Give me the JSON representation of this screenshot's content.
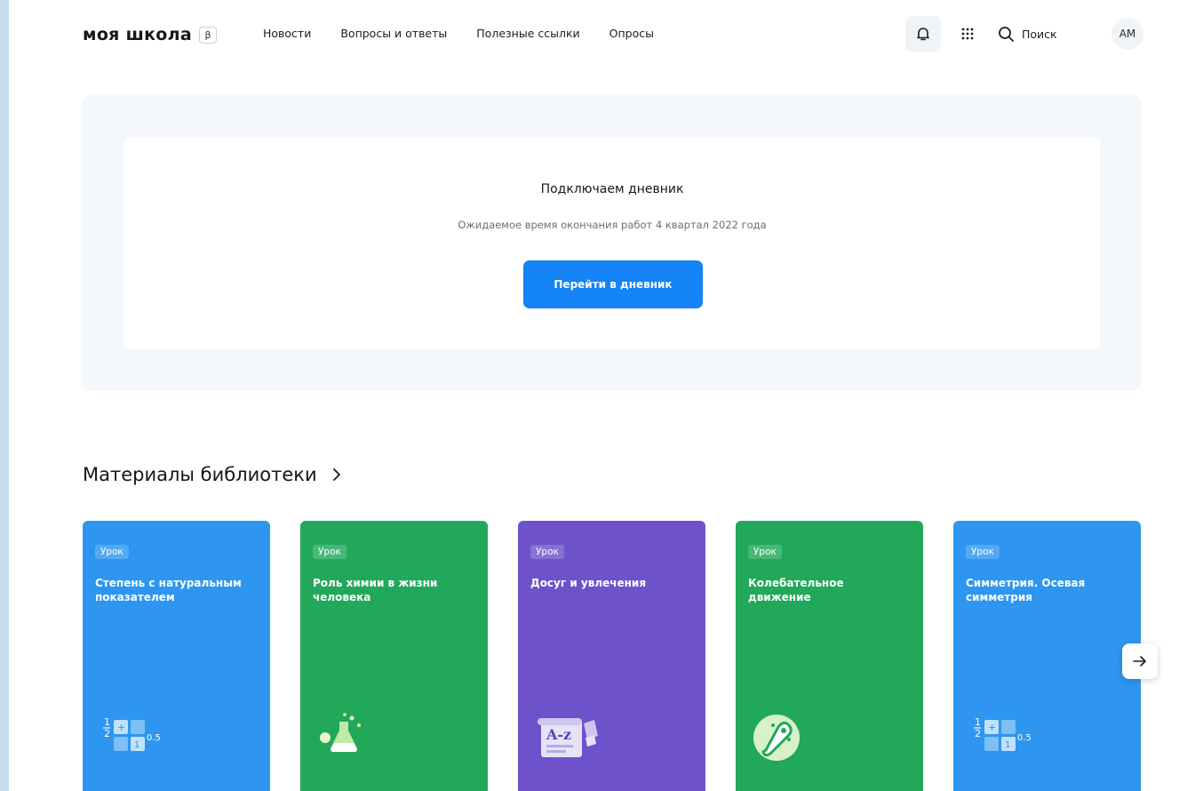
{
  "header": {
    "logo": "моя школа",
    "beta": "β",
    "nav": [
      "Новости",
      "Вопросы и ответы",
      "Полезные ссылки",
      "Опросы"
    ],
    "search_label": "Поиск",
    "avatar_initials": "АМ"
  },
  "banner": {
    "title": "Подключаем дневник",
    "subtitle": "Ожидаемое время окончания работ 4 квартал 2022 года",
    "button_label": "Перейти в дневник"
  },
  "library": {
    "title": "Материалы библиотеки",
    "cards": [
      {
        "badge": "Урок",
        "title": "Степень с натуральным показателем",
        "color": "#2e96f0",
        "icon": "math-blocks-icon"
      },
      {
        "badge": "Урок",
        "title": "Роль химии в жизни человека",
        "color": "#22a85a",
        "icon": "chemistry-flask-icon"
      },
      {
        "badge": "Урок",
        "title": "Досуг и увлечения",
        "color": "#6d52cc",
        "icon": "dictionary-scroll-icon"
      },
      {
        "badge": "Урок",
        "title": "Колебательное движение",
        "color": "#22a85a",
        "icon": "magnet-icon"
      },
      {
        "badge": "Урок",
        "title": "Симметрия. Осевая симметрия",
        "color": "#2e96f0",
        "icon": "math-blocks-icon"
      }
    ]
  },
  "colors": {
    "accent": "#1483f5",
    "page_bg": "#c6dcf2"
  }
}
